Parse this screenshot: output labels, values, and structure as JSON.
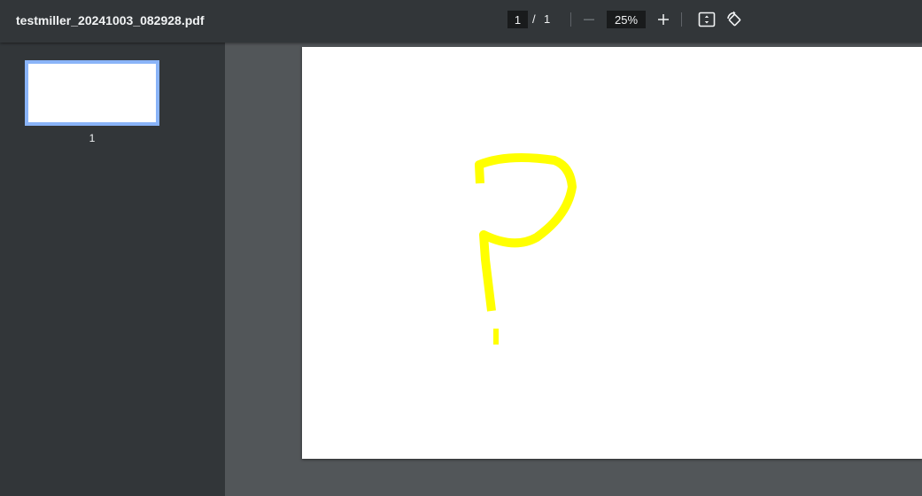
{
  "toolbar": {
    "file_title": "testmiller_20241003_082928.pdf",
    "page_current": "1",
    "page_separator": "/",
    "page_total": "1",
    "zoom_value": "25%"
  },
  "sidebar": {
    "thumbnails": [
      {
        "label": "1"
      }
    ]
  },
  "document": {
    "annotation_color": "#ffff00"
  },
  "icons": {
    "zoom_out": "minus-icon",
    "zoom_in": "plus-icon",
    "fit": "fit-to-page-icon",
    "rotate": "rotate-icon"
  },
  "colors": {
    "toolbar_bg": "#323639",
    "viewer_bg": "#525659",
    "thumbnail_selected": "#8ab4f8"
  }
}
